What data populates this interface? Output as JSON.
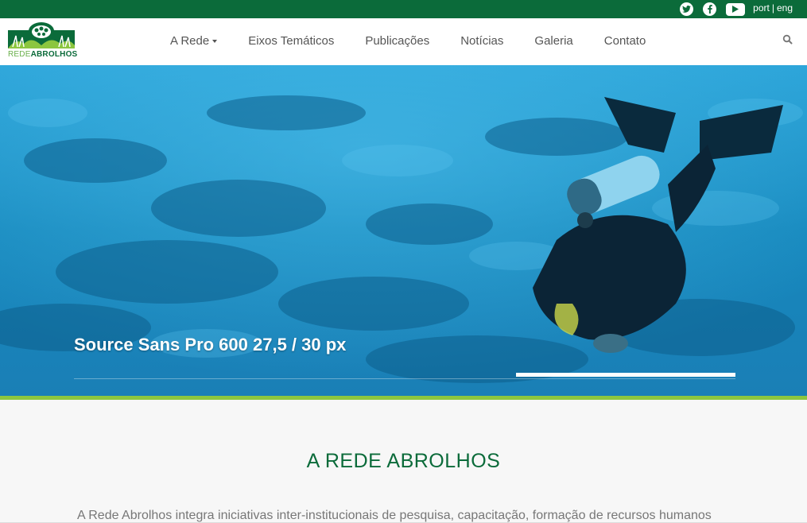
{
  "topbar": {
    "social": [
      {
        "icon": "twitter-icon"
      },
      {
        "icon": "facebook-icon"
      },
      {
        "icon": "youtube-icon"
      }
    ],
    "lang_port": "port",
    "lang_sep": "|",
    "lang_eng": "eng"
  },
  "logo": {
    "text_part1": "REDE",
    "text_part2": "ABROLHOS"
  },
  "nav": {
    "items": [
      {
        "label": "A Rede"
      },
      {
        "label": "Eixos Temáticos"
      },
      {
        "label": "Publicações"
      },
      {
        "label": "Notícias"
      },
      {
        "label": "Galeria"
      },
      {
        "label": "Contato"
      }
    ]
  },
  "hero": {
    "title": "Source Sans Pro 600 27,5 / 30 px"
  },
  "section": {
    "title": "A REDE ABROLHOS",
    "text": "A Rede Abrolhos integra iniciativas inter-institucionais de pesquisa, capacitação, formação de recursos humanos"
  },
  "colors": {
    "brand_green": "#0b6b3a",
    "accent_green": "#8cc63f",
    "water_blue": "#1a92c4"
  }
}
